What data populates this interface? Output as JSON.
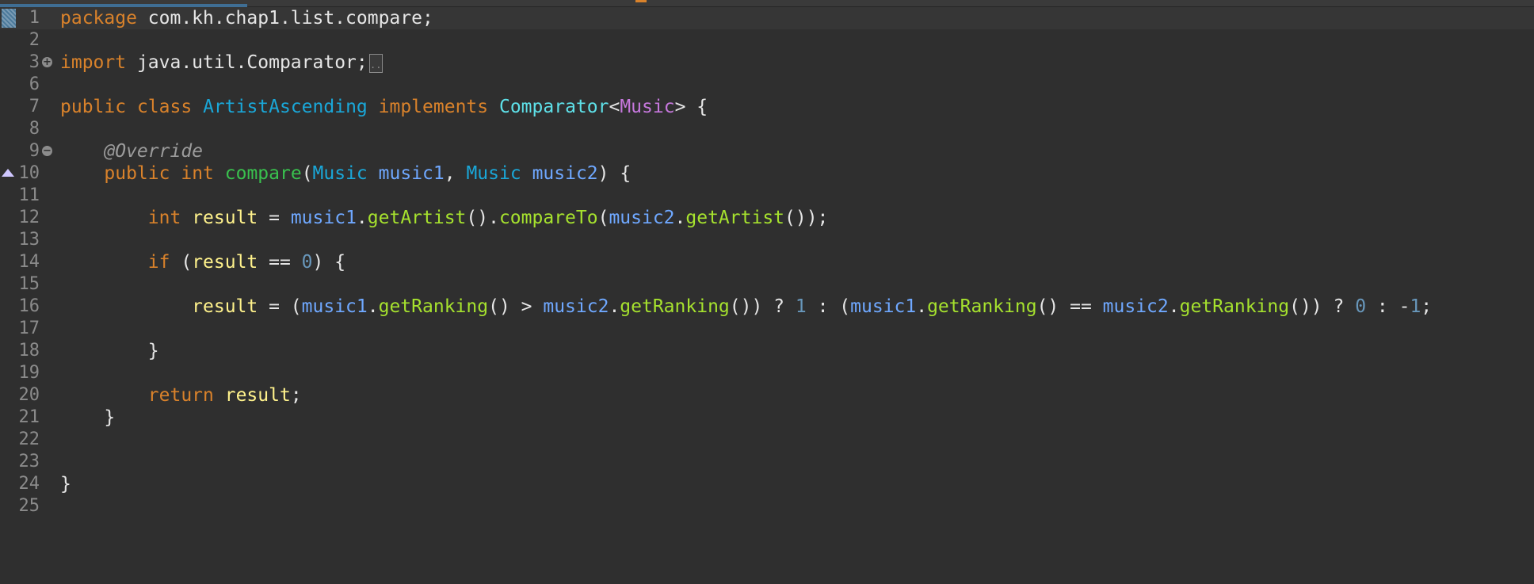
{
  "editor": {
    "lines": [
      {
        "n": "1",
        "tokens": [
          [
            "kw",
            "package"
          ],
          [
            "plain",
            " com.kh.chap1.list.compare;"
          ]
        ]
      },
      {
        "n": "2",
        "tokens": []
      },
      {
        "n": "3",
        "tokens": [
          [
            "kw",
            "import"
          ],
          [
            "plain",
            " java.util.Comparator;"
          ]
        ]
      },
      {
        "n": "6",
        "tokens": []
      },
      {
        "n": "7",
        "tokens": [
          [
            "kw",
            "public"
          ],
          [
            "plain",
            " "
          ],
          [
            "kw",
            "class"
          ],
          [
            "plain",
            " "
          ],
          [
            "type",
            "ArtistAscending"
          ],
          [
            "plain",
            " "
          ],
          [
            "kw",
            "implements"
          ],
          [
            "plain",
            " "
          ],
          [
            "type2",
            "Comparator"
          ],
          [
            "plain",
            "<"
          ],
          [
            "tp",
            "Music"
          ],
          [
            "plain",
            "> {"
          ]
        ]
      },
      {
        "n": "8",
        "tokens": []
      },
      {
        "n": "9",
        "tokens": [
          [
            "plain",
            "    "
          ],
          [
            "anno",
            "@Override"
          ]
        ]
      },
      {
        "n": "10",
        "tokens": [
          [
            "plain",
            "    "
          ],
          [
            "kw",
            "public"
          ],
          [
            "plain",
            " "
          ],
          [
            "kw",
            "int"
          ],
          [
            "plain",
            " "
          ],
          [
            "mdecl",
            "compare"
          ],
          [
            "plain",
            "("
          ],
          [
            "type",
            "Music"
          ],
          [
            "plain",
            " "
          ],
          [
            "local",
            "music1"
          ],
          [
            "plain",
            ", "
          ],
          [
            "type",
            "Music"
          ],
          [
            "plain",
            " "
          ],
          [
            "local",
            "music2"
          ],
          [
            "plain",
            ") {"
          ]
        ]
      },
      {
        "n": "11",
        "tokens": []
      },
      {
        "n": "12",
        "tokens": [
          [
            "plain",
            "        "
          ],
          [
            "kw",
            "int"
          ],
          [
            "plain",
            " "
          ],
          [
            "var",
            "result"
          ],
          [
            "plain",
            " = "
          ],
          [
            "local",
            "music1"
          ],
          [
            "plain",
            "."
          ],
          [
            "method",
            "getArtist"
          ],
          [
            "plain",
            "()."
          ],
          [
            "method",
            "compareTo"
          ],
          [
            "plain",
            "("
          ],
          [
            "local",
            "music2"
          ],
          [
            "plain",
            "."
          ],
          [
            "method",
            "getArtist"
          ],
          [
            "plain",
            "());"
          ]
        ]
      },
      {
        "n": "13",
        "tokens": []
      },
      {
        "n": "14",
        "tokens": [
          [
            "plain",
            "        "
          ],
          [
            "kw",
            "if"
          ],
          [
            "plain",
            " ("
          ],
          [
            "var",
            "result"
          ],
          [
            "plain",
            " == "
          ],
          [
            "num",
            "0"
          ],
          [
            "plain",
            ") {"
          ]
        ]
      },
      {
        "n": "15",
        "tokens": []
      },
      {
        "n": "16",
        "tokens": [
          [
            "plain",
            "            "
          ],
          [
            "var",
            "result"
          ],
          [
            "plain",
            " = ("
          ],
          [
            "local",
            "music1"
          ],
          [
            "plain",
            "."
          ],
          [
            "method",
            "getRanking"
          ],
          [
            "plain",
            "() > "
          ],
          [
            "local",
            "music2"
          ],
          [
            "plain",
            "."
          ],
          [
            "method",
            "getRanking"
          ],
          [
            "plain",
            "()) ? "
          ],
          [
            "num",
            "1"
          ],
          [
            "plain",
            " : ("
          ],
          [
            "local",
            "music1"
          ],
          [
            "plain",
            "."
          ],
          [
            "method",
            "getRanking"
          ],
          [
            "plain",
            "() == "
          ],
          [
            "local",
            "music2"
          ],
          [
            "plain",
            "."
          ],
          [
            "method",
            "getRanking"
          ],
          [
            "plain",
            "()) ? "
          ],
          [
            "num",
            "0"
          ],
          [
            "plain",
            " : -"
          ],
          [
            "num",
            "1"
          ],
          [
            "plain",
            ";"
          ]
        ]
      },
      {
        "n": "17",
        "tokens": []
      },
      {
        "n": "18",
        "tokens": [
          [
            "plain",
            "        }"
          ]
        ]
      },
      {
        "n": "19",
        "tokens": []
      },
      {
        "n": "20",
        "tokens": [
          [
            "plain",
            "        "
          ],
          [
            "kw",
            "return"
          ],
          [
            "plain",
            " "
          ],
          [
            "var",
            "result"
          ],
          [
            "plain",
            ";"
          ]
        ]
      },
      {
        "n": "21",
        "tokens": [
          [
            "plain",
            "    }"
          ]
        ]
      },
      {
        "n": "22",
        "tokens": []
      },
      {
        "n": "23",
        "tokens": []
      },
      {
        "n": "24",
        "tokens": [
          [
            "plain",
            "}"
          ]
        ]
      },
      {
        "n": "25",
        "tokens": []
      }
    ],
    "fold_expand_glyph": "+",
    "fold_collapse_glyph": "−",
    "collapsed_marker": "..",
    "colors": {
      "background": "#2f2f2f",
      "keyword": "#d9822b",
      "type": "#1aa7d8",
      "method": "#a6e22e",
      "field": "#fff28c",
      "local": "#6fa8ff",
      "number": "#6897bb"
    }
  }
}
